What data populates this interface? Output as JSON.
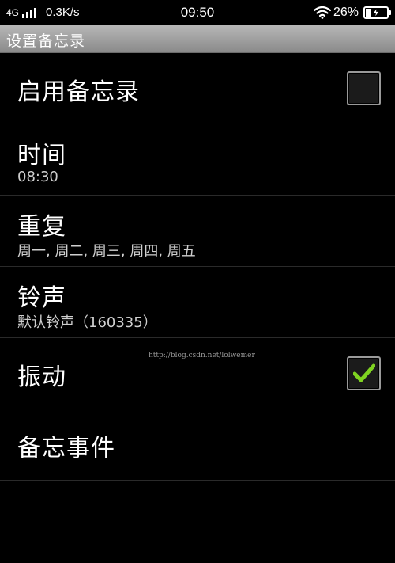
{
  "status_bar": {
    "network": "4G",
    "speed": "0.3K/s",
    "time": "09:50",
    "battery": "26%",
    "battery_level": 0.26,
    "icons": [
      "signal-icon",
      "wifi-icon",
      "battery-icon",
      "charging-icon"
    ]
  },
  "title": "设置备忘录",
  "settings": {
    "enable": {
      "title": "启用备忘录",
      "checked": false
    },
    "time": {
      "title": "时间",
      "summary": "08:30"
    },
    "repeat": {
      "title": "重复",
      "summary": "周一, 周二, 周三, 周四, 周五"
    },
    "ringtone": {
      "title": "铃声",
      "summary": "默认铃声（160335）"
    },
    "vibrate": {
      "title": "振动",
      "checked": true
    },
    "event": {
      "title": "备忘事件"
    }
  },
  "watermark": "http://blog.csdn.net/lolwemer",
  "colors": {
    "checkmark": "#7fd321",
    "title_bar": "#a0a0a0",
    "background": "#000000"
  }
}
